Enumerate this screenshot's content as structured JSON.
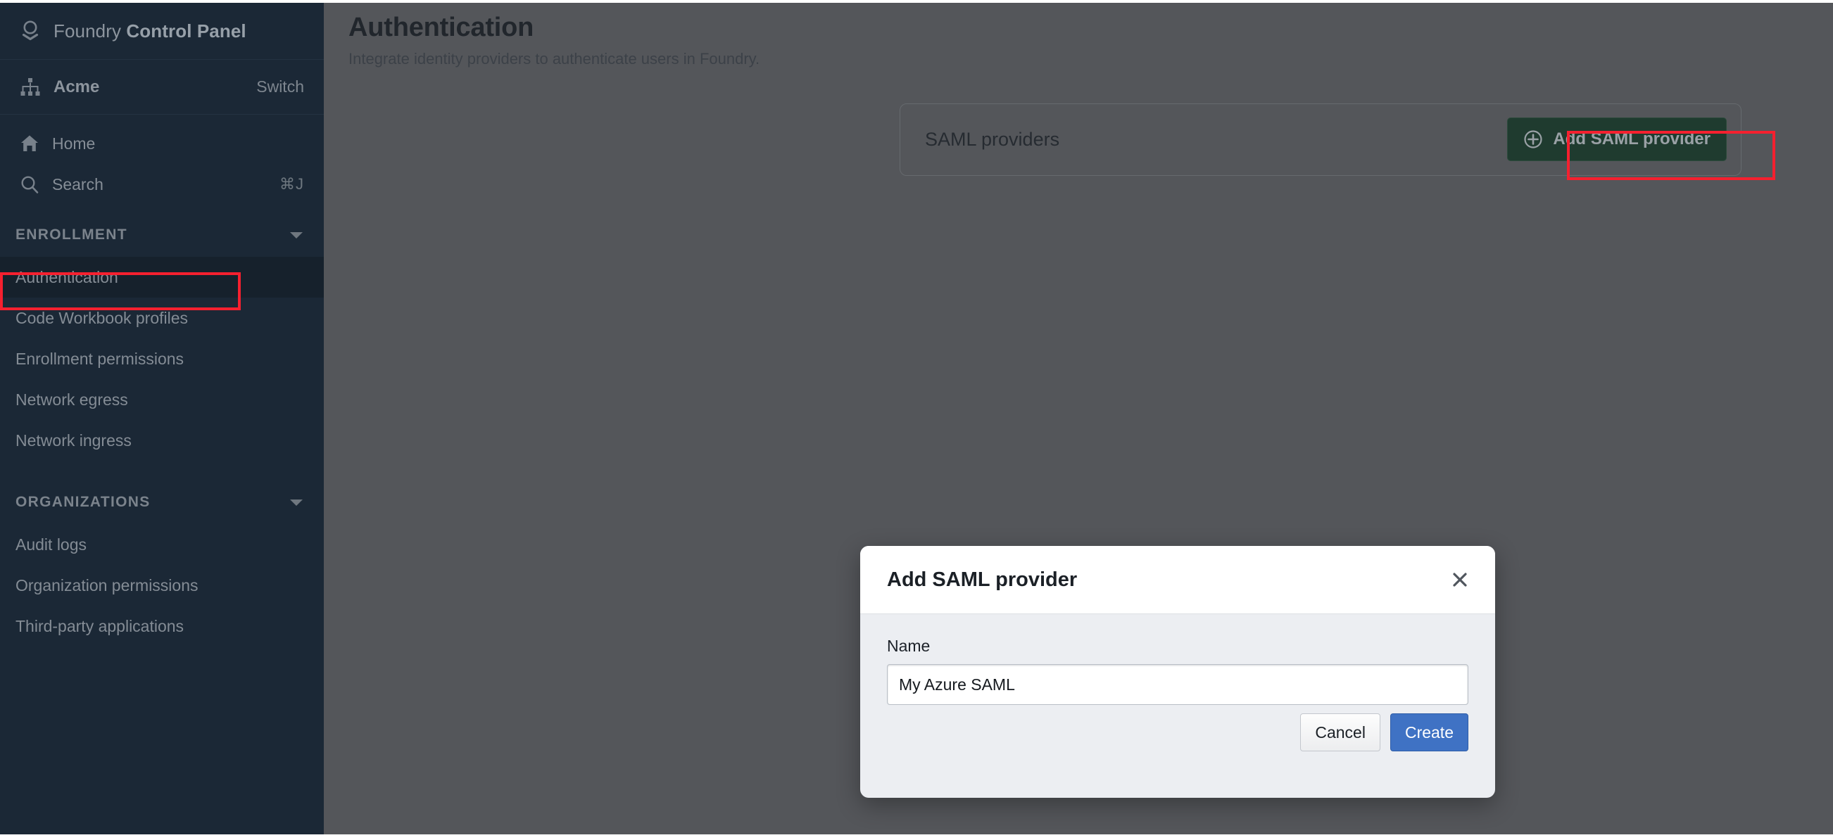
{
  "sidebar": {
    "brand": {
      "name_light": "Foundry ",
      "name_bold": "Control Panel",
      "icon": "foundry-logo-icon"
    },
    "org": {
      "name": "Acme",
      "switch_label": "Switch",
      "icon": "org-hierarchy-icon"
    },
    "links": [
      {
        "label": "Home",
        "icon": "home-icon",
        "shortcut": ""
      },
      {
        "label": "Search",
        "icon": "search-icon",
        "shortcut": "⌘J"
      }
    ],
    "sections": [
      {
        "label": "ENROLLMENT",
        "caret": "chevron-down-icon",
        "items": [
          {
            "label": "Authentication",
            "active": true
          },
          {
            "label": "Code Workbook profiles",
            "active": false
          },
          {
            "label": "Enrollment permissions",
            "active": false
          },
          {
            "label": "Network egress",
            "active": false
          },
          {
            "label": "Network ingress",
            "active": false
          }
        ]
      },
      {
        "label": "ORGANIZATIONS",
        "caret": "chevron-down-icon",
        "items": [
          {
            "label": "Audit logs",
            "active": false
          },
          {
            "label": "Organization permissions",
            "active": false
          },
          {
            "label": "Third-party applications",
            "active": false
          }
        ]
      }
    ]
  },
  "page": {
    "title": "Authentication",
    "subtitle": "Integrate identity providers to authenticate users in Foundry."
  },
  "saml_card": {
    "title": "SAML providers",
    "add_button": {
      "label": "Add SAML provider",
      "icon": "plus-circle-icon"
    }
  },
  "modal": {
    "title": "Add SAML provider",
    "close_icon": "close-icon",
    "field": {
      "label": "Name",
      "value": "My Azure SAML",
      "placeholder": ""
    },
    "buttons": {
      "cancel": "Cancel",
      "create": "Create"
    }
  },
  "colors": {
    "sidebar_bg": "#1b2836",
    "sidebar_active_bg": "#16212c",
    "page_bg": "#54565a",
    "add_button_bg": "#1f3b2f",
    "create_button_bg": "#3f72c4",
    "annotation": "#f5202f",
    "modal_body_bg": "#eceef2",
    "modal_head_bg": "#ffffff"
  }
}
